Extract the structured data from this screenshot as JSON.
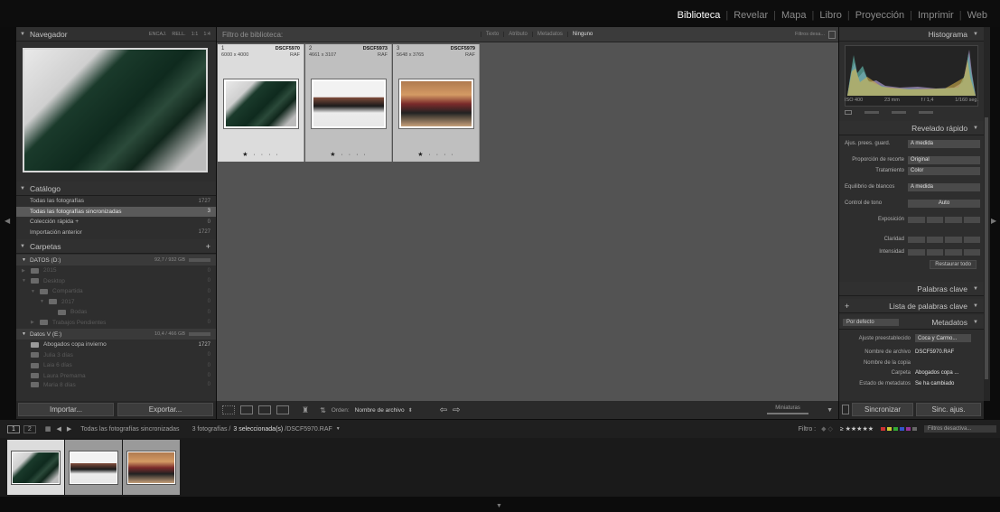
{
  "modules": [
    {
      "label": "Biblioteca",
      "active": true
    },
    {
      "label": "Revelar",
      "active": false
    },
    {
      "label": "Mapa",
      "active": false
    },
    {
      "label": "Libro",
      "active": false
    },
    {
      "label": "Proyección",
      "active": false
    },
    {
      "label": "Imprimir",
      "active": false
    },
    {
      "label": "Web",
      "active": false
    }
  ],
  "navigator": {
    "title": "Navegador",
    "opts": [
      "ENCAJ.",
      "RELL.",
      "1:1",
      "1:4"
    ]
  },
  "catalog": {
    "title": "Catálogo",
    "items": [
      {
        "label": "Todas las fotografías",
        "count": "1727"
      },
      {
        "label": "Todas las fotografías sincronizadas",
        "count": "3"
      },
      {
        "label": "Colección rápida  +",
        "count": "0"
      },
      {
        "label": "Importación anterior",
        "count": "1727"
      }
    ]
  },
  "folders": {
    "title": "Carpetas",
    "volume1": {
      "label": "DATOS (D:)",
      "cap": "92,7 / 932 GB"
    },
    "volume1_items": [
      {
        "label": "2015",
        "count": "0"
      },
      {
        "label": "Desktop",
        "count": "0"
      },
      {
        "label": "Compartida",
        "count": "0"
      },
      {
        "label": "2017",
        "count": "0"
      },
      {
        "label": "Bodas",
        "count": "0"
      },
      {
        "label": "Trabajos Pendientes",
        "count": "0"
      }
    ],
    "volume2": {
      "label": "Datos V (E:)",
      "cap": "10,4 / 466 GB"
    },
    "volume2_items": [
      {
        "label": "Abogados copa invierno",
        "count": "1727"
      },
      {
        "label": "Julia 3 días",
        "count": "0"
      },
      {
        "label": "Laia 6 días",
        "count": "0"
      },
      {
        "label": "Laura Premama",
        "count": "0"
      },
      {
        "label": "Maria 8 días",
        "count": "0"
      }
    ]
  },
  "left_buttons": {
    "import": "Importar...",
    "export": "Exportar..."
  },
  "filter_bar": {
    "title": "Filtro de biblioteca:",
    "tabs": [
      "Texto",
      "Atributo",
      "Metadatos",
      "Ninguno"
    ],
    "preset": "Filtros desa..."
  },
  "grid": [
    {
      "index": "1",
      "name": "DSCF5970",
      "dims": "6000 x 4000",
      "ext": "RAF",
      "stars": "★ · · · ·",
      "selected": true
    },
    {
      "index": "2",
      "name": "DSCF5973",
      "dims": "4661 x 3107",
      "ext": "RAF",
      "stars": "★ · · · ·",
      "selected": false
    },
    {
      "index": "3",
      "name": "DSCF5979",
      "dims": "5648 x 3765",
      "ext": "RAF",
      "stars": "★ · · · ·",
      "selected": false
    }
  ],
  "toolbar": {
    "order_label": "Orden:",
    "order_value": "Nombre de archivo",
    "thumbs_label": "Miniaturas"
  },
  "histogram": {
    "title": "Histograma",
    "iso": "ISO 400",
    "focal": "23 mm",
    "aperture": "f / 1,4",
    "shutter": "1/160 seg."
  },
  "quick_develop": {
    "title": "Revelado rápido",
    "preset_label": "Ajus. prees. guard.",
    "preset_value": "A medida",
    "crop_label": "Proporción de recorte",
    "crop_value": "Original",
    "treatment_label": "Tratamiento",
    "treatment_value": "Color",
    "wb_label": "Equilibrio de blancos",
    "wb_value": "A medida",
    "tone_label": "Control de tono",
    "tone_auto": "Auto",
    "exposure_label": "Exposición",
    "clarity_label": "Claridad",
    "vibrance_label": "Intensidad",
    "reset": "Restaurar todo"
  },
  "keywords": {
    "title": "Palabras clave"
  },
  "keyword_list": {
    "title": "Lista de palabras clave"
  },
  "metadata": {
    "title": "Metadatos",
    "preset_select": "Por defecto",
    "rows": [
      {
        "label": "Ajuste preestablecido",
        "value": "Coca y Carmo..."
      },
      {
        "label": "Nombre de archivo",
        "value": "DSCF5970.RAF"
      },
      {
        "label": "Nombre de la copia",
        "value": ""
      },
      {
        "label": "Carpeta",
        "value": "Abogados copa ..."
      },
      {
        "label": "Estado de metadatos",
        "value": "Se ha cambiado"
      }
    ]
  },
  "right_buttons": {
    "sync": "Sincronizar",
    "sync_settings": "Sinc. ajus."
  },
  "filmstrip_header": {
    "pages": [
      "1",
      "2"
    ],
    "source": "Todas las fotografías sincronizadas",
    "count_text": "3 fotografías /",
    "selected_text": "3 seleccionada(s)",
    "path": "/DSCF5970.RAF",
    "filter_label": "Filtro :",
    "filter_preset": "Filtros desactiva..."
  }
}
